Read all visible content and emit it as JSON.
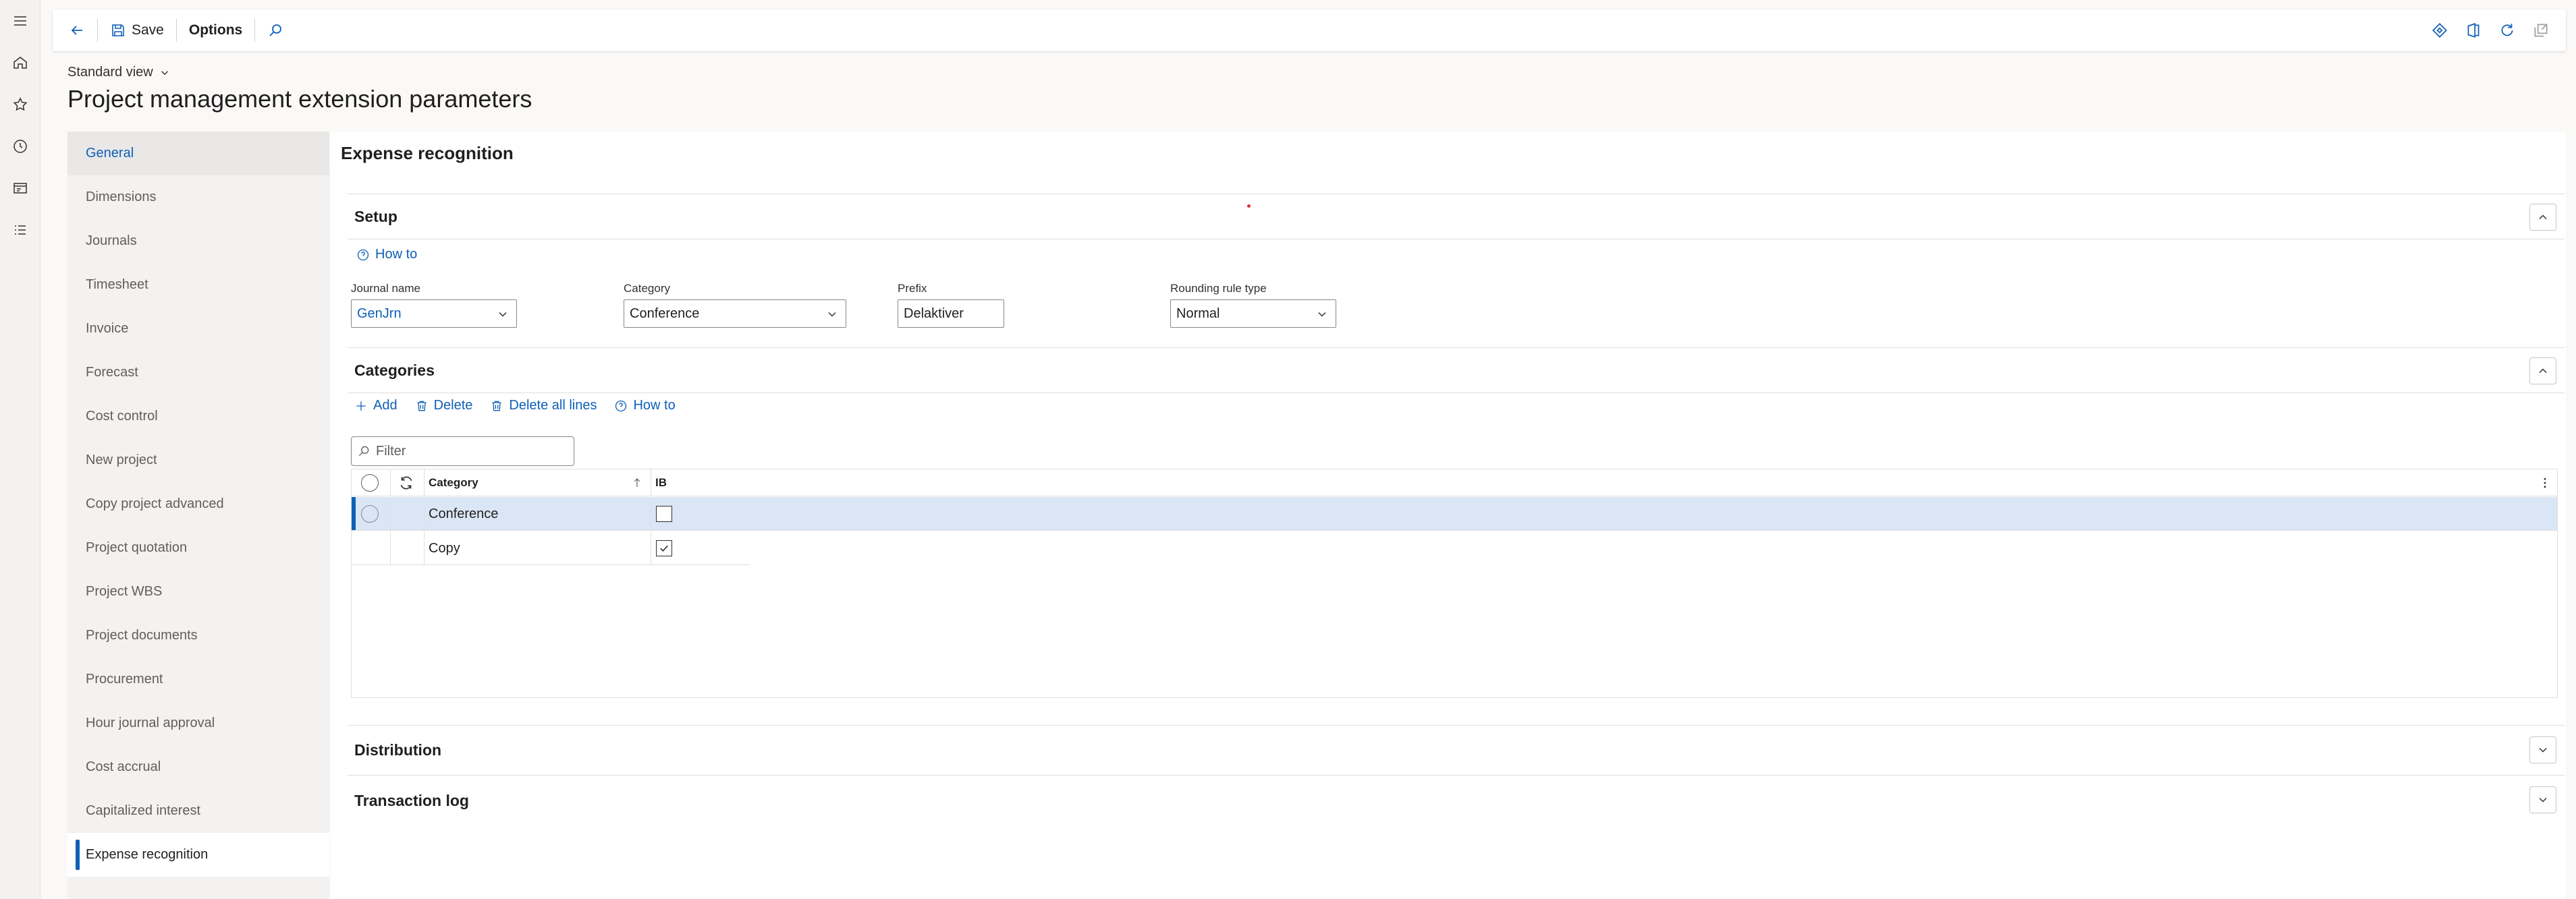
{
  "leftrail": {
    "icons": [
      "hamburger-icon",
      "home-icon",
      "star-icon",
      "clock-icon",
      "workspace-icon",
      "list-icon"
    ]
  },
  "actionbar": {
    "save_label": "Save",
    "options_label": "Options"
  },
  "view": {
    "label": "Standard view"
  },
  "page": {
    "title": "Project management extension parameters"
  },
  "nav": {
    "items": [
      "General",
      "Dimensions",
      "Journals",
      "Timesheet",
      "Invoice",
      "Forecast",
      "Cost control",
      "New project",
      "Copy project advanced",
      "Project quotation",
      "Project WBS",
      "Project documents",
      "Procurement",
      "Hour journal approval",
      "Cost accrual",
      "Capitalized interest",
      "Expense recognition"
    ],
    "selected": "Expense recognition"
  },
  "section": {
    "title": "Expense recognition"
  },
  "setup": {
    "title": "Setup",
    "howto_label": "How to",
    "journal_name": {
      "label": "Journal name",
      "value": "GenJrn"
    },
    "category": {
      "label": "Category",
      "value": "Conference"
    },
    "prefix": {
      "label": "Prefix",
      "value": "Delaktiver"
    },
    "rounding": {
      "label": "Rounding rule type",
      "value": "Normal"
    }
  },
  "categories": {
    "title": "Categories",
    "toolbar": {
      "add": "Add",
      "delete": "Delete",
      "delete_all": "Delete all lines",
      "howto": "How to"
    },
    "filter_placeholder": "Filter",
    "columns": {
      "category": "Category",
      "ib": "IB"
    },
    "rows": [
      {
        "category": "Conference",
        "ib": false
      },
      {
        "category": "Copy",
        "ib": true
      }
    ]
  },
  "distribution": {
    "title": "Distribution"
  },
  "transaction_log": {
    "title": "Transaction log"
  },
  "colors": {
    "accent": "#0f5fb8",
    "selected_row": "#dae6f6",
    "nav_bg": "#f3f2f1"
  }
}
